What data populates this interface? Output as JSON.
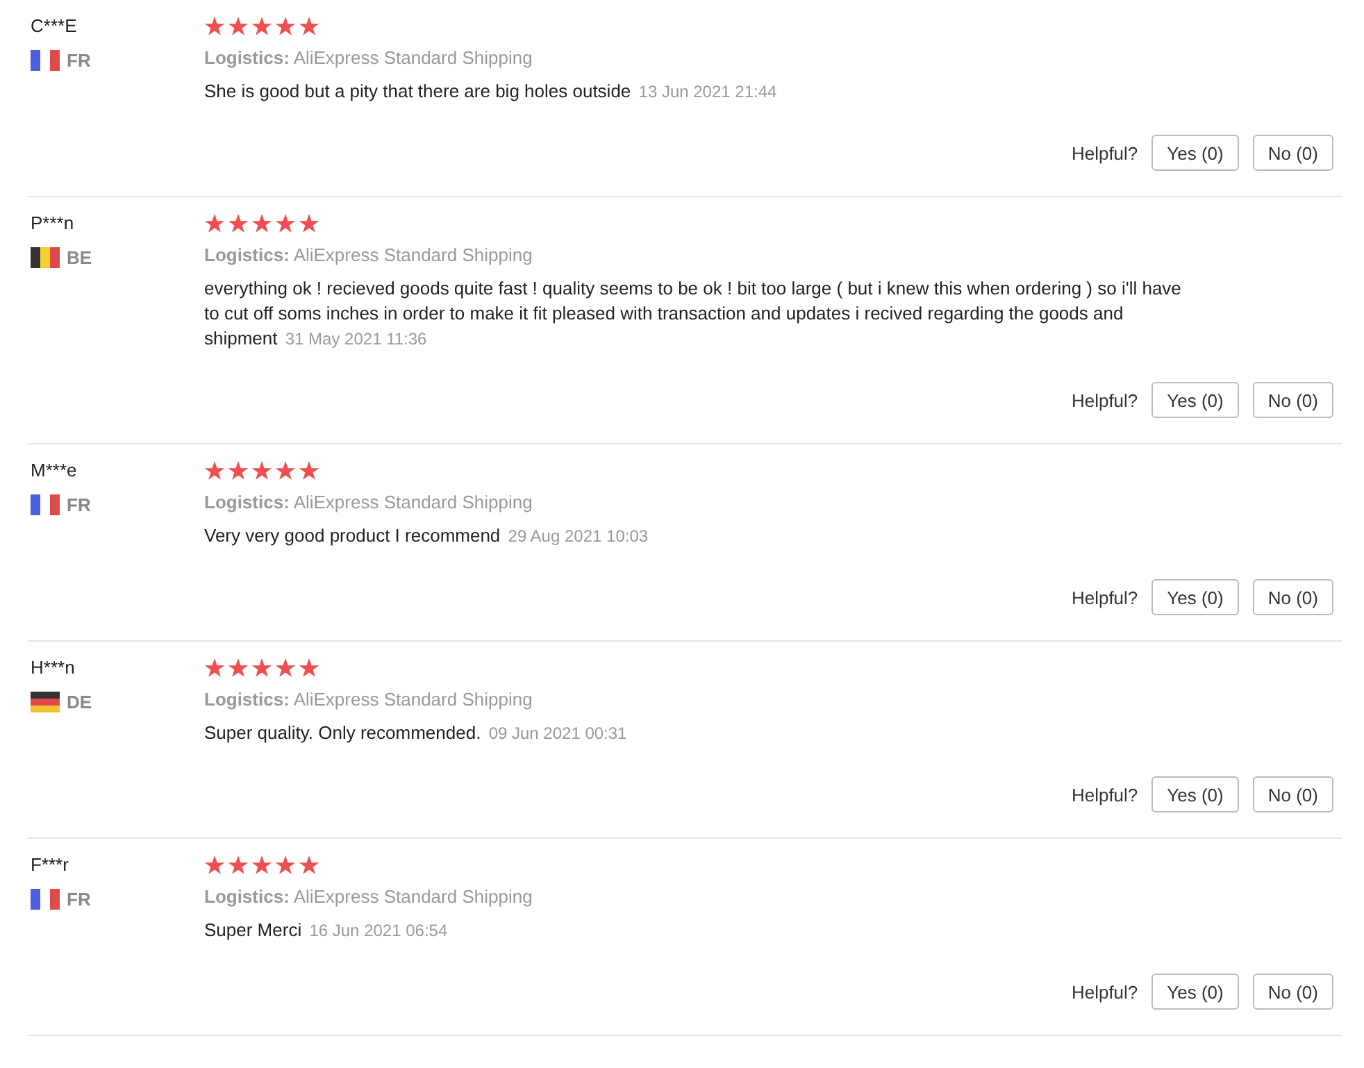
{
  "reviews": [
    {
      "user": "C***E",
      "country": "FR",
      "flag": {
        "kind": "fr"
      },
      "stars": 5,
      "logistics_label": "Logistics:",
      "logistics": "AliExpress Standard Shipping",
      "text": "She is good but a pity that there are big holes outside",
      "date": "13 Jun 2021 21:44",
      "helpful_label": "Helpful?",
      "yes": "Yes (0)",
      "no": "No (0)"
    },
    {
      "user": "P***n",
      "country": "BE",
      "flag": {
        "kind": "be"
      },
      "stars": 5,
      "logistics_label": "Logistics:",
      "logistics": "AliExpress Standard Shipping",
      "text": "everything ok ! recieved goods quite fast ! quality seems to be ok ! bit too large ( but i knew this when ordering ) so i'll have to cut off soms inches in order to make it fit pleased with transaction and updates i recived regarding the goods and shipment",
      "date": "31 May 2021 11:36",
      "helpful_label": "Helpful?",
      "yes": "Yes (0)",
      "no": "No (0)"
    },
    {
      "user": "M***e",
      "country": "FR",
      "flag": {
        "kind": "fr"
      },
      "stars": 5,
      "logistics_label": "Logistics:",
      "logistics": "AliExpress Standard Shipping",
      "text": "Very very good product I recommend",
      "date": "29 Aug 2021 10:03",
      "helpful_label": "Helpful?",
      "yes": "Yes (0)",
      "no": "No (0)"
    },
    {
      "user": "H***n",
      "country": "DE",
      "flag": {
        "kind": "de"
      },
      "stars": 5,
      "logistics_label": "Logistics:",
      "logistics": "AliExpress Standard Shipping",
      "text": "Super quality. Only recommended.",
      "date": "09 Jun 2021 00:31",
      "helpful_label": "Helpful?",
      "yes": "Yes (0)",
      "no": "No (0)"
    },
    {
      "user": "F***r",
      "country": "FR",
      "flag": {
        "kind": "fr"
      },
      "stars": 5,
      "logistics_label": "Logistics:",
      "logistics": "AliExpress Standard Shipping",
      "text": "Super Merci",
      "date": "16 Jun 2021 06:54",
      "helpful_label": "Helpful?",
      "yes": "Yes (0)",
      "no": "No (0)"
    }
  ]
}
